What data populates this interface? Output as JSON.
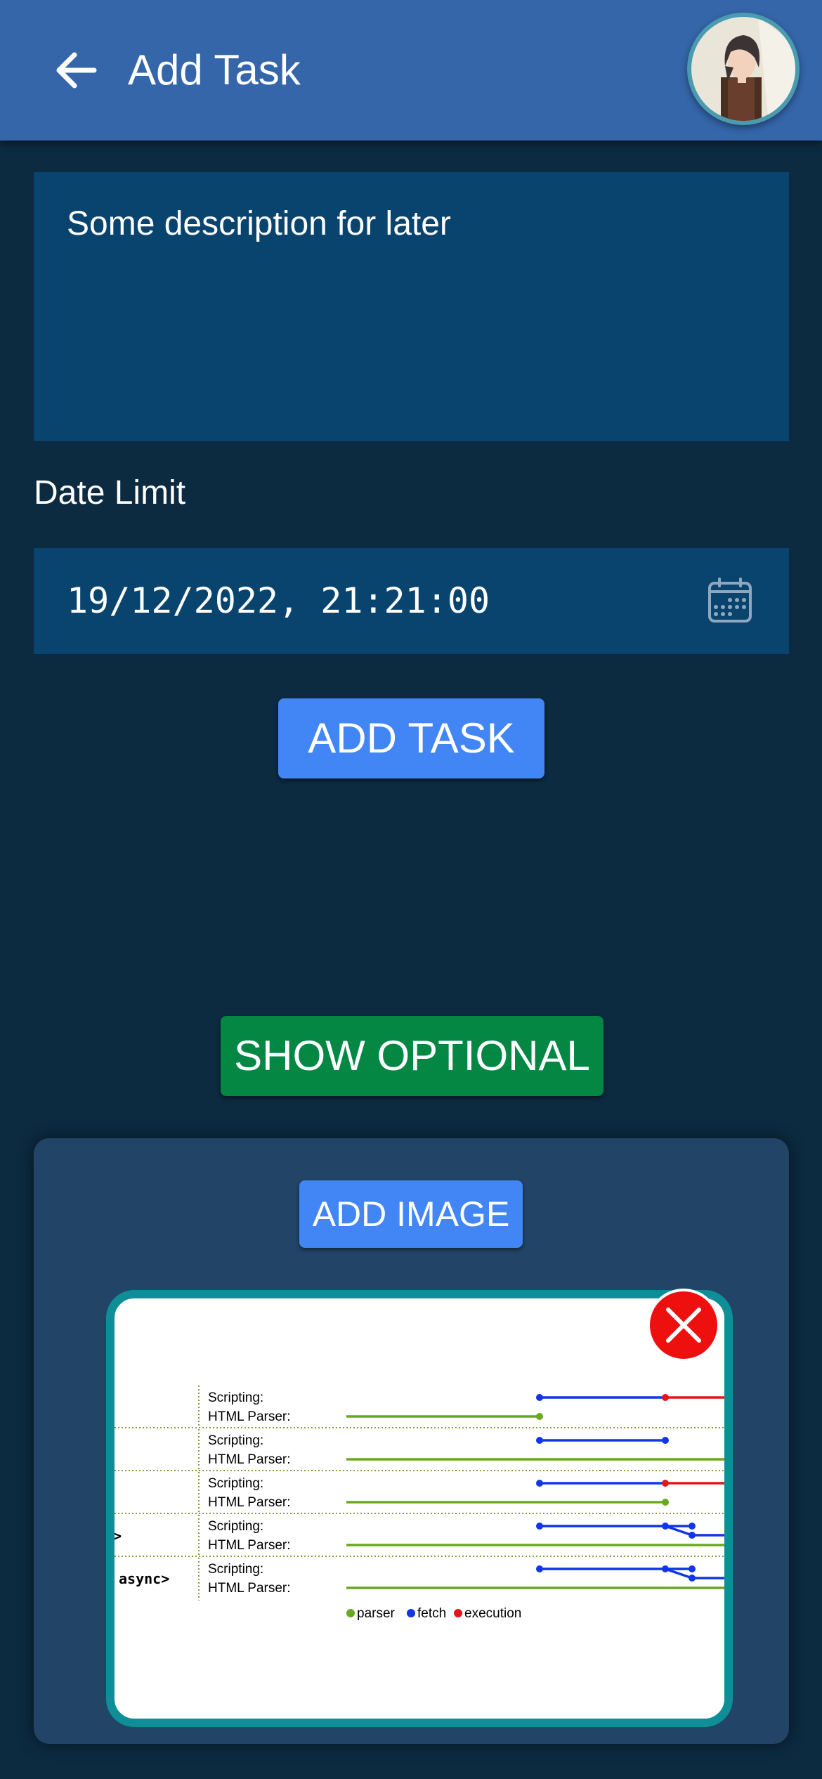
{
  "appbar": {
    "title": "Add Task"
  },
  "form": {
    "description_value": "Some description for later",
    "date_label": "Date Limit",
    "date_value": "19/12/2022, 21:21:00",
    "add_task_label": "ADD TASK",
    "show_optional_label": "SHOW OPTIONAL"
  },
  "optional": {
    "add_image_label": "ADD IMAGE",
    "image": {
      "rows": [
        {
          "label": "",
          "scripting": "Scripting:",
          "parser": "HTML Parser:"
        },
        {
          "label": "",
          "scripting": "Scripting:",
          "parser": "HTML Parser:"
        },
        {
          "label": "",
          "scripting": "Scripting:",
          "parser": "HTML Parser:"
        },
        {
          "label": ">",
          "scripting": "Scripting:",
          "parser": "HTML Parser:"
        },
        {
          "label": "async>",
          "scripting": "Scripting:",
          "parser": "HTML Parser:"
        }
      ],
      "legend": [
        "parser",
        "fetch",
        "execution"
      ]
    }
  },
  "icons": {
    "back": "arrow-left-icon",
    "calendar": "calendar-icon",
    "remove": "close-icon"
  },
  "colors": {
    "appbar": "#3566aa",
    "background": "#0c2a40",
    "field": "#09446f",
    "primary_button": "#4285f4",
    "secondary_button": "#058744",
    "remove_button": "#ee0f0f",
    "parser": "#6aa820",
    "fetch": "#1036e6",
    "execution": "#e01818"
  }
}
